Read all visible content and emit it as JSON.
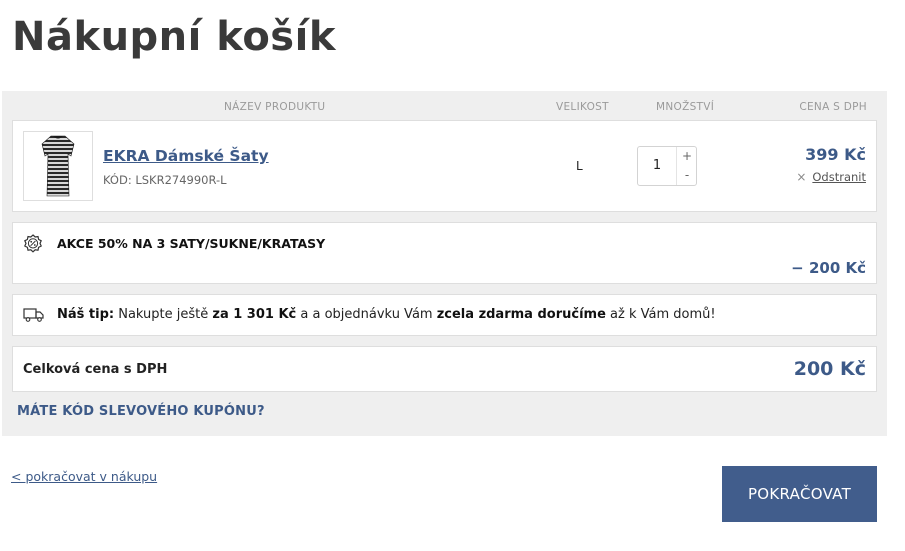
{
  "page": {
    "title": "Nákupní košík"
  },
  "table_headers": {
    "product_name": "NÁZEV PRODUKTU",
    "size": "VELIKOST",
    "quantity": "MNOŽSTVÍ",
    "price": "CENA S DPH"
  },
  "product": {
    "name": "EKRA Dámské Šaty",
    "code": "KÓD: LSKR274990R-L",
    "size": "L",
    "quantity": "1",
    "qty_plus": "+",
    "qty_minus": "-",
    "price": "399 Kč",
    "remove_icon": "×",
    "remove_label": "Odstranit",
    "image_icon": "dress-thumbnail"
  },
  "promo": {
    "icon": "percent-badge-icon",
    "title": "AKCE 50% NA 3 SATY/SUKNE/KRATASY",
    "amount": "− 200 Kč"
  },
  "tip": {
    "icon": "truck-icon",
    "label": "Náš tip:",
    "text_1": " Nakupte ještě ",
    "amount": "za 1 301 Kč",
    "text_2": " a a objednávku Vám ",
    "highlight": "zcela zdarma doručíme",
    "text_3": " až k Vám domů!"
  },
  "total": {
    "label": "Celková cena s DPH",
    "value": "200 Kč"
  },
  "coupon": {
    "label": "MÁTE KÓD SLEVOVÉHO KUPÓNU?"
  },
  "footer": {
    "continue_shopping": "< pokračovat v nákupu",
    "continue_button": "POKRAČOVAT"
  },
  "colors": {
    "accent": "#415d8c",
    "link": "#3d5a88",
    "panel_bg": "#efefef"
  }
}
